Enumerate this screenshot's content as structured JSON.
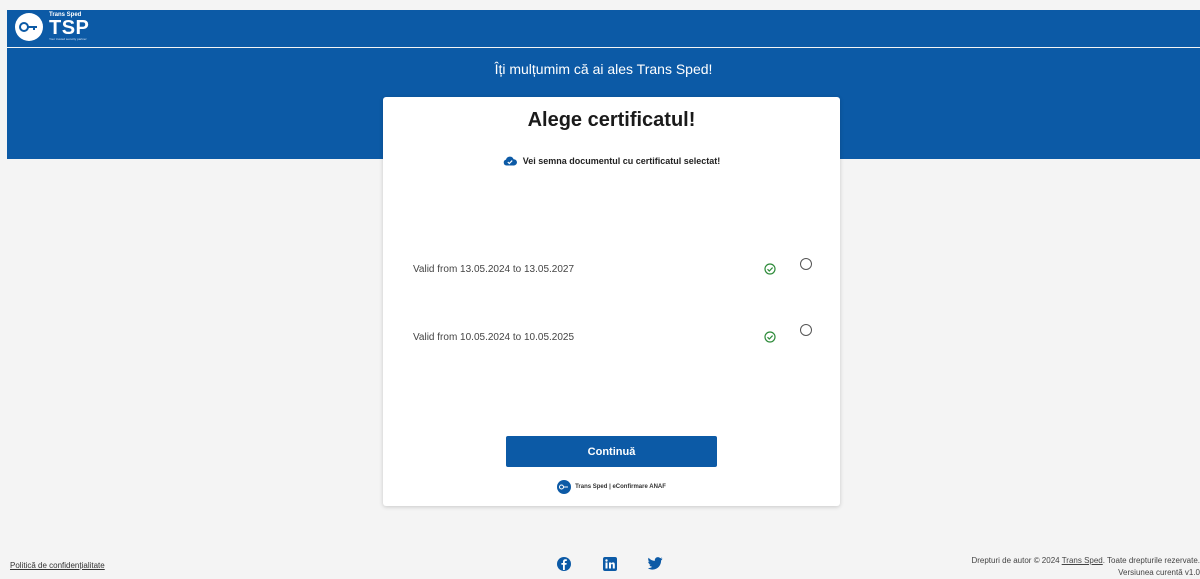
{
  "header": {
    "logo_small": "Trans Sped",
    "logo_big": "TSP",
    "logo_tagline": "Your trusted security partner"
  },
  "hero": {
    "thanks_text": "Îți mulțumim că ai ales Trans Sped!"
  },
  "card": {
    "title": "Alege certificatul!",
    "subtitle": "Vei semna documentul cu certificatul selectat!",
    "certificates": [
      {
        "label": "Valid from 13.05.2024 to 13.05.2027",
        "valid": true,
        "selected": false
      },
      {
        "label": "Valid from 10.05.2024 to 10.05.2025",
        "valid": true,
        "selected": false
      }
    ],
    "continue_label": "Continuă",
    "footer_text": "Trans Sped | eConfirmare ANAF"
  },
  "footer": {
    "privacy_label": "Politică de confidențialitate",
    "copyright_prefix": "Drepturi de autor © 2024 ",
    "copyright_link": "Trans Sped",
    "copyright_suffix": ". Toate drepturile rezervate.",
    "version_text": "Versiunea curentă v1.0"
  },
  "social": [
    "facebook-icon",
    "linkedin-icon",
    "twitter-icon"
  ],
  "colors": {
    "brand_blue": "#0c5aa6",
    "valid_green": "#2e8b3a",
    "background": "#f4f4f4"
  }
}
